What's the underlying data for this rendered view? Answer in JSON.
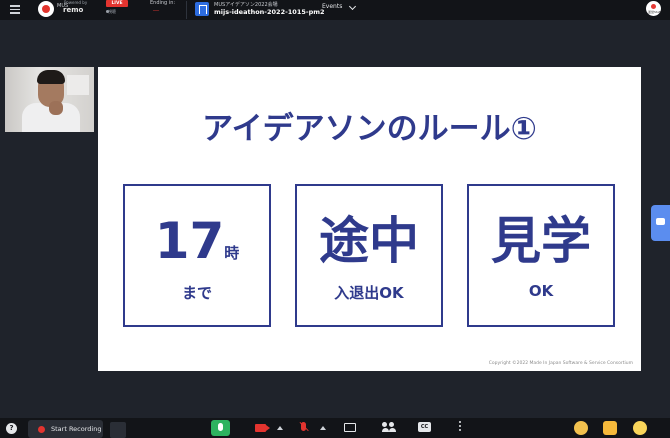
{
  "topbar": {
    "menu_icon": "hamburger-icon",
    "org_short": "MUS",
    "powered_by": "Powered by",
    "brand": "remo",
    "live_label": "LIVE",
    "live_sub": "視聴",
    "ending_label": "Ending in:",
    "ending_value": "──",
    "event_org": "MUSアイデアソン2022会場",
    "event_name": "mijs-ideathon-2022-1015-pm2",
    "events_label": "Events",
    "avatar_text": "運営Staff"
  },
  "slide": {
    "title": "アイデアソンのルール①",
    "boxes": [
      {
        "big": "17",
        "big_small": "時",
        "sub": "まで"
      },
      {
        "big": "途中",
        "sub": "入退出OK"
      },
      {
        "big": "見学",
        "sub": "OK"
      }
    ],
    "copyright": "Copyright ©2022 Made In Japan Software & Service Consortium"
  },
  "bottombar": {
    "help": "?",
    "record_label": "Start Recording",
    "cc_label": "CC"
  },
  "colors": {
    "slide_accent": "#2f3a8c",
    "live_red": "#e3342f",
    "mic_green": "#2db35f",
    "chat_tab_blue": "#5b8def"
  }
}
